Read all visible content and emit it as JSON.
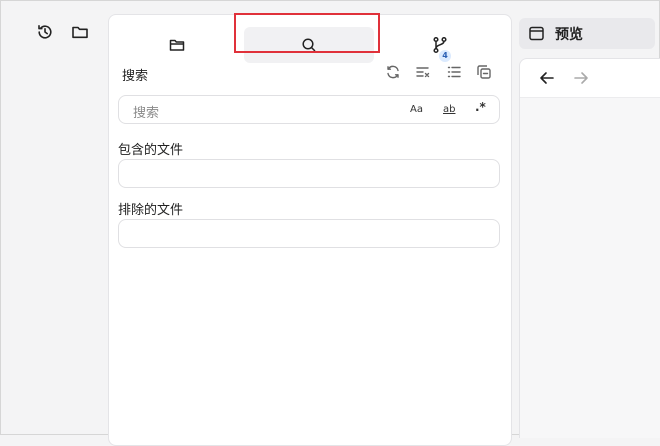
{
  "sidebar": {
    "icons": [
      "history-icon",
      "folder-icon"
    ]
  },
  "panel": {
    "tabs": [
      {
        "name": "files",
        "icon": "folder-open-icon"
      },
      {
        "name": "search",
        "icon": "search-icon",
        "active": true
      },
      {
        "name": "git",
        "icon": "git-branch-icon",
        "badge": "4"
      }
    ],
    "git_badge": "4",
    "section_title": "搜索",
    "toolbar_icons": [
      "refresh-icon",
      "clear-results-icon",
      "list-view-icon",
      "collapse-all-icon"
    ],
    "search": {
      "placeholder": "搜索",
      "options": {
        "match_case": "Aa",
        "whole_word": "ab",
        "regex": ".*"
      }
    },
    "include_label": "包含的文件",
    "exclude_label": "排除的文件"
  },
  "preview": {
    "tab_label": "预览",
    "icons": [
      "window-icon",
      "back-arrow-icon",
      "forward-arrow-icon"
    ]
  },
  "colors": {
    "highlight": "#e0313a",
    "active_tab_bg": "#f1f1f3",
    "badge_bg": "#dbeafe",
    "badge_text": "#2b5fb3"
  }
}
